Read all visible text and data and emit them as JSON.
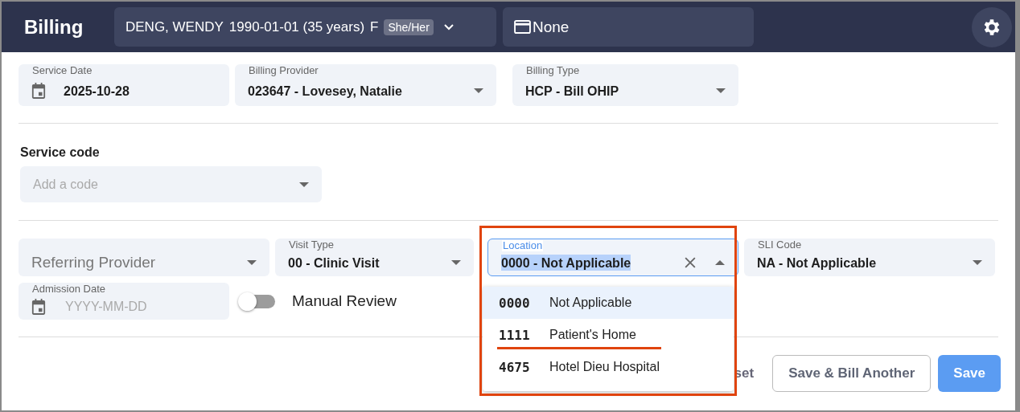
{
  "header": {
    "title": "Billing",
    "patient": {
      "name": "DENG, WENDY",
      "dob": "1990-01-01 (35 years)",
      "sex": "F",
      "pronouns": "She/Her"
    },
    "insurance": "None"
  },
  "service_date": {
    "label": "Service Date",
    "value": "2025-10-28"
  },
  "billing_provider": {
    "label": "Billing Provider",
    "value": "023647 - Lovesey, Natalie"
  },
  "billing_type": {
    "label": "Billing Type",
    "value": "HCP - Bill OHIP"
  },
  "service_code": {
    "heading": "Service code",
    "placeholder": "Add a code"
  },
  "referring_provider": {
    "placeholder": "Referring Provider"
  },
  "visit_type": {
    "label": "Visit Type",
    "value": "00 - Clinic Visit"
  },
  "location": {
    "label": "Location",
    "value": "0000 - Not Applicable",
    "expanded": true,
    "value_selected": true,
    "annotated": true,
    "options": [
      {
        "code": "0000",
        "name": "Not Applicable",
        "selected": true,
        "underlined": false
      },
      {
        "code": "1111",
        "name": "Patient's Home",
        "selected": false,
        "underlined": true
      },
      {
        "code": "4675",
        "name": "Hotel Dieu Hospital",
        "selected": false,
        "underlined": false
      }
    ]
  },
  "sli_code": {
    "label": "SLI Code",
    "value": "NA - Not Applicable"
  },
  "admission_date": {
    "label": "Admission Date",
    "placeholder": "YYYY-MM-DD"
  },
  "manual_review": {
    "label": "Manual Review",
    "on": false
  },
  "buttons": [
    {
      "label": "set",
      "kind": "text"
    },
    {
      "label": "Save & Bill Another",
      "kind": "outlined"
    },
    {
      "label": "Save",
      "kind": "primary"
    }
  ]
}
